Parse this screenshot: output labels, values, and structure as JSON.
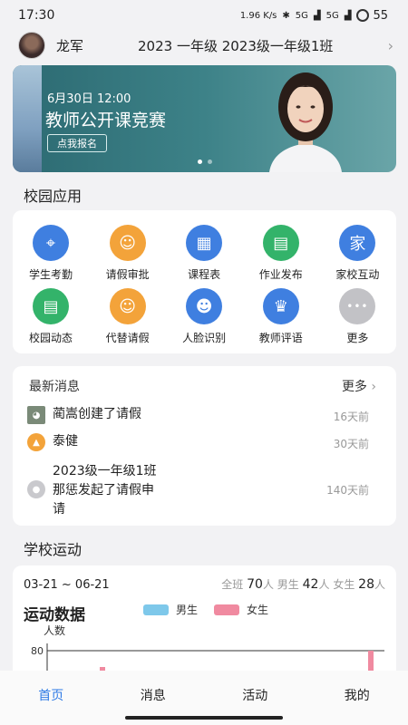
{
  "status": {
    "time": "17:30",
    "speed": "1.96 K/s",
    "net1": "5G",
    "net2": "5G",
    "battery": "55"
  },
  "user": {
    "name": "龙军",
    "class": "2023 一年级 2023级一年级1班"
  },
  "banner": {
    "date": "6月30日 12:00",
    "title": "教师公开课竞赛",
    "button": "点我报名"
  },
  "apps_section": {
    "title": "校园应用"
  },
  "apps": [
    {
      "label": "学生考勤",
      "icon": "location-icon",
      "color": "#3f7fe0",
      "glyph": "⌖"
    },
    {
      "label": "请假审批",
      "icon": "leave-approval-icon",
      "color": "#f3a33a",
      "glyph": "☺"
    },
    {
      "label": "课程表",
      "icon": "calendar-icon",
      "color": "#3f7fe0",
      "glyph": "▦"
    },
    {
      "label": "作业发布",
      "icon": "book-icon",
      "color": "#33b36a",
      "glyph": "▤"
    },
    {
      "label": "家校互动",
      "icon": "home-school-icon",
      "color": "#3f7fe0",
      "glyph": "家"
    },
    {
      "label": "校园动态",
      "icon": "news-icon",
      "color": "#33b36a",
      "glyph": "▤"
    },
    {
      "label": "代替请假",
      "icon": "proxy-leave-icon",
      "color": "#f3a33a",
      "glyph": "☺"
    },
    {
      "label": "人脸识别",
      "icon": "face-scan-icon",
      "color": "#3f7fe0",
      "glyph": "☻"
    },
    {
      "label": "教师评语",
      "icon": "trophy-icon",
      "color": "#3f7fe0",
      "glyph": "♛"
    },
    {
      "label": "更多",
      "icon": "more-icon",
      "color": "#c2c2c6",
      "glyph": "•••"
    }
  ],
  "news": {
    "title": "最新消息",
    "more": "更多",
    "items": [
      {
        "text": "蔺嵩创建了请假",
        "time": "16天前",
        "icon": "user-photo-icon"
      },
      {
        "text": "泰健",
        "time": "30天前",
        "icon": "graduation-cap-icon"
      },
      {
        "text_lines": [
          "2023级一年级1班",
          "那惩发起了请假申",
          "请"
        ],
        "time": "140天前",
        "icon": "default-user-icon"
      }
    ]
  },
  "sports_section": {
    "title": "学校运动"
  },
  "sports": {
    "date_range": "03-21 ~ 06-21",
    "all_label": "全班",
    "all_count": "70",
    "male_label": "男生",
    "male_count": "42",
    "female_label": "女生",
    "female_count": "28",
    "unit": "人",
    "title": "运动数据",
    "male_color": "#7ec8ea",
    "female_color": "#f08aa0"
  },
  "chart_data": {
    "type": "bar",
    "ylabel": "人数",
    "yticks": [
      "80"
    ],
    "series": [
      {
        "name": "男生",
        "color": "#7ec8ea"
      },
      {
        "name": "女生",
        "color": "#f08aa0"
      }
    ]
  },
  "tabs": [
    "首页",
    "消息",
    "活动",
    "我的"
  ],
  "active_tab": "首页"
}
